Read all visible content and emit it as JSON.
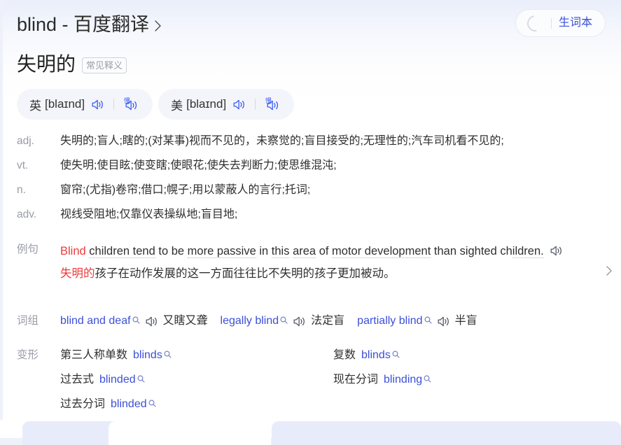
{
  "header": {
    "title": "blind - 百度翻译",
    "title_chevron_icon": "chevron-right-icon",
    "vocab_button": {
      "spinner_icon": "loading-spinner-icon",
      "label": "生词本"
    }
  },
  "word": {
    "headword_cn": "失明的",
    "badge": "常见释义"
  },
  "phonetics": [
    {
      "lang": "英",
      "ipa": "[blaɪnd]",
      "speaker_icon": "speaker-icon",
      "slow_speaker_icon": "slow-speaker-icon",
      "slow_glyph": "慢"
    },
    {
      "lang": "美",
      "ipa": "[blaɪnd]",
      "speaker_icon": "speaker-icon",
      "slow_speaker_icon": "slow-speaker-icon",
      "slow_glyph": "慢"
    }
  ],
  "definitions": [
    {
      "pos": "adj.",
      "text": "失明的;盲人;瞎的;(对某事)视而不见的，未察觉的;盲目接受的;无理性的;汽车司机看不见的;"
    },
    {
      "pos": "vt.",
      "text": "使失明;使目眩;使变瞎;使眼花;使失去判断力;使思维混沌;"
    },
    {
      "pos": "n.",
      "text": "窗帘;(尤指)卷帘;借口;幌子;用以蒙蔽人的言行;托词;"
    },
    {
      "pos": "adv.",
      "text": "视线受阻地;仅靠仪表操纵地;盲目地;"
    }
  ],
  "example": {
    "label": "例句",
    "en_highlight": "Blind",
    "en_rest": " children tend to be more passive in this area of motor development than sighted children.",
    "en_segments": [
      {
        "text": "Blind",
        "style": "highlight"
      },
      {
        "text": " ",
        "style": "plain"
      },
      {
        "text": "children tend",
        "style": "dotted"
      },
      {
        "text": " to be ",
        "style": "plain"
      },
      {
        "text": "more passive",
        "style": "dotted"
      },
      {
        "text": " in ",
        "style": "plain"
      },
      {
        "text": "this",
        "style": "dotted"
      },
      {
        "text": " ",
        "style": "plain"
      },
      {
        "text": "area",
        "style": "dotted"
      },
      {
        "text": " of ",
        "style": "plain"
      },
      {
        "text": "motor development",
        "style": "dotted"
      },
      {
        "text": " than sighted ch",
        "style": "plain"
      },
      {
        "text": "ildren.",
        "style": "dotted-partial"
      }
    ],
    "speaker_icon": "speaker-icon",
    "cn_highlight": "失明的",
    "cn_rest": "孩子在动作发展的这一方面往往比不失明的孩子更加被动。",
    "arrow_icon": "chevron-right-icon"
  },
  "phrases": {
    "label": "词组",
    "items": [
      {
        "en": "blind and deaf",
        "search_icon": "search-icon",
        "speaker_icon": "speaker-icon",
        "cn": "又瞎又聋"
      },
      {
        "en": "legally blind",
        "search_icon": "search-icon",
        "speaker_icon": "speaker-icon",
        "cn": "法定盲"
      },
      {
        "en": "partially blind",
        "search_icon": "search-icon",
        "speaker_icon": "speaker-icon",
        "cn": "半盲"
      }
    ]
  },
  "inflections": {
    "label": "变形",
    "items": [
      {
        "name": "第三人称单数",
        "value": "blinds",
        "search_icon": "search-icon"
      },
      {
        "name": "复数",
        "value": "blinds",
        "search_icon": "search-icon"
      },
      {
        "name": "过去式",
        "value": "blinded",
        "search_icon": "search-icon"
      },
      {
        "name": "现在分词",
        "value": "blinding",
        "search_icon": "search-icon"
      },
      {
        "name": "过去分词",
        "value": "blinded",
        "search_icon": "search-icon"
      }
    ]
  },
  "colors": {
    "link": "#3b4fd8",
    "highlight": "#ee3b3b",
    "label_gray": "#9a9da8",
    "text": "#2f2f2f",
    "pill_bg": "#f4f5fa"
  }
}
